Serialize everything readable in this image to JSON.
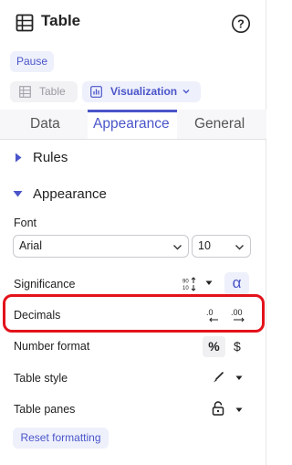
{
  "header": {
    "title": "Table",
    "icon": "table-icon",
    "help_icon": "help-circle-icon"
  },
  "toolbar": {
    "pause_label": "Pause",
    "table_label": "Table",
    "visualization_label": "Visualization"
  },
  "tabs": [
    {
      "label": "Data",
      "active": false
    },
    {
      "label": "Appearance",
      "active": true
    },
    {
      "label": "General",
      "active": false
    }
  ],
  "sections": {
    "rules": {
      "label": "Rules",
      "expanded": false
    },
    "appearance": {
      "label": "Appearance",
      "expanded": true
    }
  },
  "font": {
    "label": "Font",
    "family_value": "Arial",
    "size_value": "10"
  },
  "rows": {
    "significance": {
      "label": "Significance",
      "icons": [
        "significance-arrows-icon",
        "caret-down-icon",
        "alpha-icon"
      ],
      "alpha_glyph": "α"
    },
    "decimals": {
      "label": "Decimals",
      "icons": [
        "decrease-decimals-icon",
        "increase-decimals-icon"
      ]
    },
    "number_format": {
      "label": "Number format",
      "percent_glyph": "%",
      "dollar_glyph": "$"
    },
    "table_style": {
      "label": "Table style",
      "icons": [
        "brush-icon",
        "caret-down-icon"
      ]
    },
    "table_panes": {
      "label": "Table panes",
      "icons": [
        "lock-icon",
        "caret-down-icon"
      ]
    }
  },
  "reset": {
    "label": "Reset formatting"
  },
  "colors": {
    "accent": "#4a55c9",
    "highlight": "#e3121b"
  }
}
